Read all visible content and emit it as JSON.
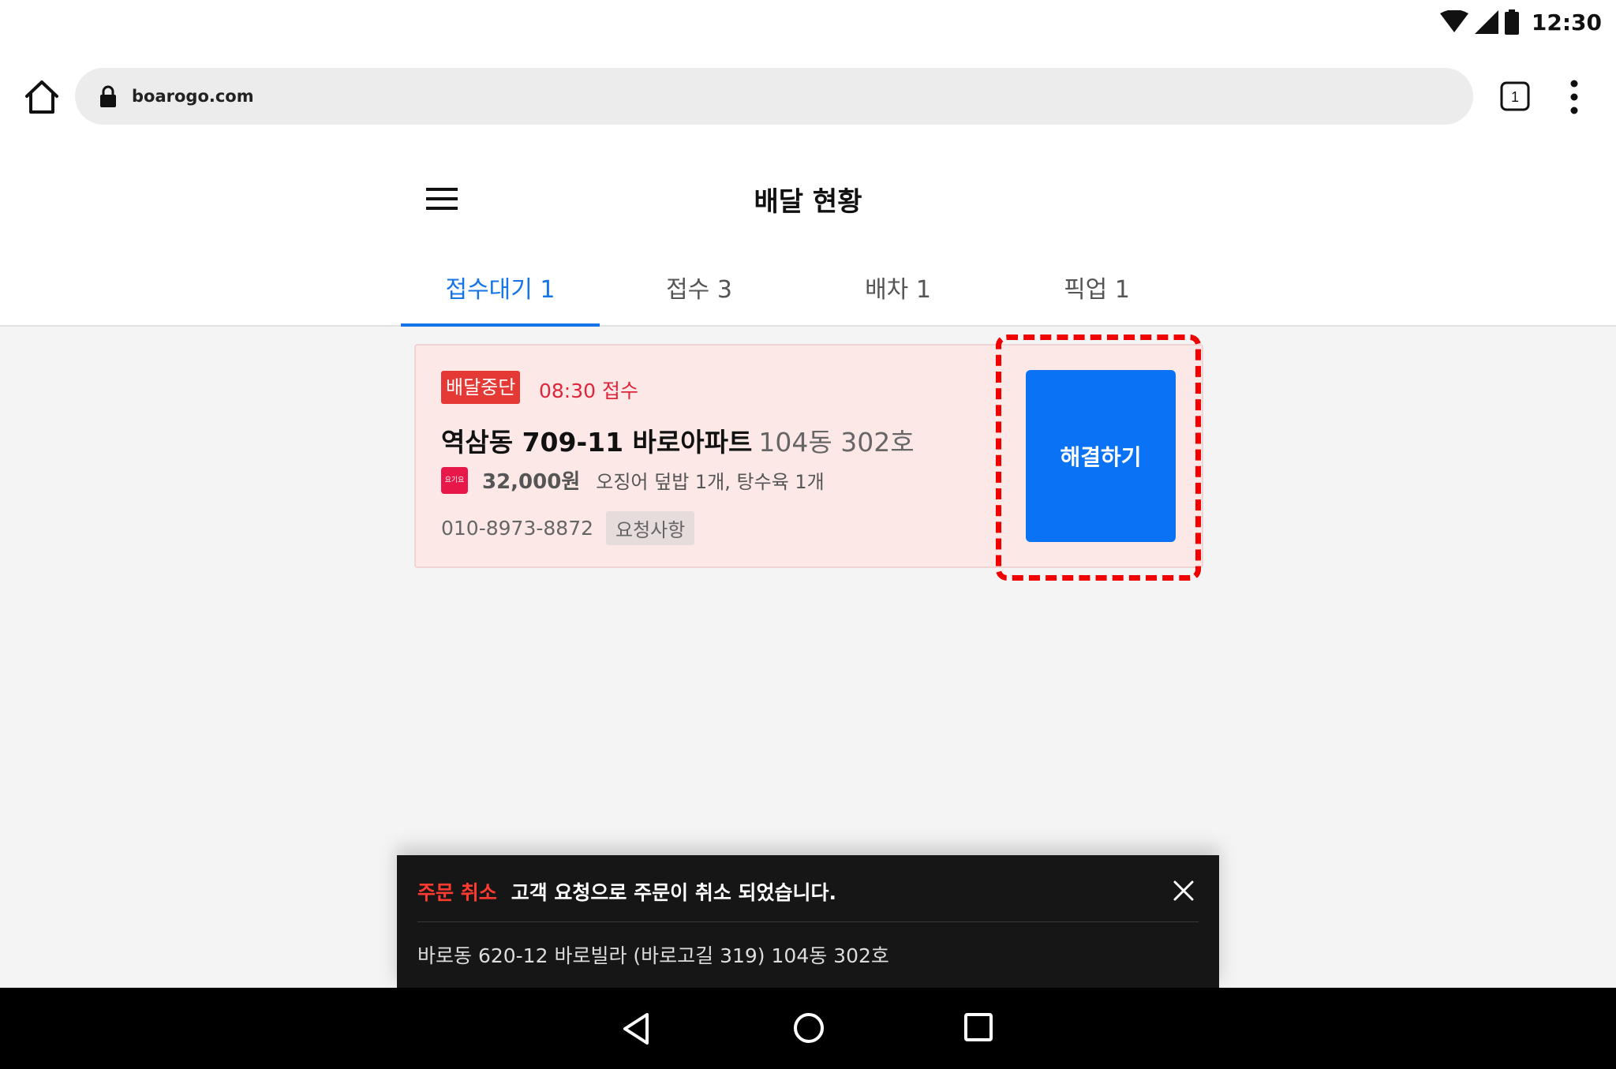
{
  "status_bar": {
    "time": "12:30",
    "icons": [
      "wifi-icon",
      "signal-icon",
      "battery-icon"
    ]
  },
  "browser": {
    "url": "boarogo.com",
    "tab_count": "1"
  },
  "app": {
    "title": "배달 현황"
  },
  "tabs": [
    {
      "label": "접수대기 1",
      "active": true
    },
    {
      "label": "접수 3",
      "active": false
    },
    {
      "label": "배차 1",
      "active": false
    },
    {
      "label": "픽업 1",
      "active": false
    }
  ],
  "order": {
    "badge": "배달중단",
    "received_time": "08:30 접수",
    "address_main": "역삼동 709-11 바로아파트",
    "address_detail": "104동 302호",
    "platform_icon_text": "요기요",
    "price": "32,000원",
    "items": "오징어 덮밥 1개, 탕수육 1개",
    "phone": "010-8973-8872",
    "request_label": "요청사항",
    "action_label": "해결하기"
  },
  "toast": {
    "kind": "주문 취소",
    "message": "고객 요청으로 주문이 취소 되었습니다.",
    "address": "바로동 620-12 바로빌라 (바로고길 319) 104동 302호"
  },
  "colors": {
    "accent": "#1474e8",
    "button": "#0a72f5",
    "badge": "#e53935",
    "card_bg": "#fde8e8",
    "toast_bg": "#161616",
    "toast_kind": "#ff3b30",
    "highlight": "#f20000"
  }
}
